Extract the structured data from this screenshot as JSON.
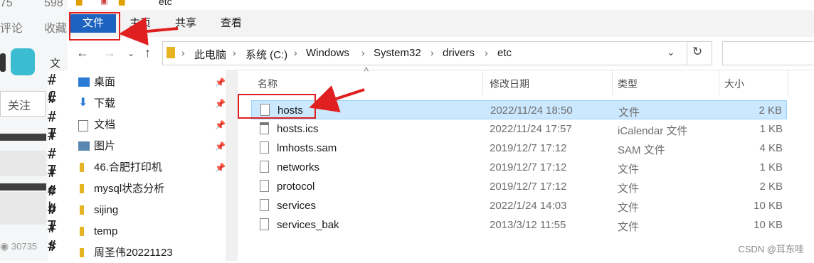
{
  "background": {
    "stat_a": "75",
    "stat_b": "598",
    "comment_label": "评论",
    "favorite_label": "收藏",
    "follow_label": "关注",
    "menu_label": "文",
    "view_count": "30735",
    "hash_lines": [
      "# C",
      "#",
      "# T",
      "#",
      "# T",
      "# e",
      "# b",
      "# T",
      "# s",
      "#"
    ]
  },
  "window": {
    "title": "etc",
    "ribbon_tabs": [
      "文件",
      "主页",
      "共享",
      "查看"
    ],
    "path": [
      "此电脑",
      "系统 (C:)",
      "Windows",
      "System32",
      "drivers",
      "etc"
    ],
    "nav_items": [
      {
        "label": "桌面",
        "icon": "desktop-icon",
        "pinned": true
      },
      {
        "label": "下载",
        "icon": "download-icon",
        "pinned": true
      },
      {
        "label": "文档",
        "icon": "document-icon",
        "pinned": true
      },
      {
        "label": "图片",
        "icon": "picture-icon",
        "pinned": true
      },
      {
        "label": "46.合肥打印机",
        "icon": "folder-icon",
        "pinned": true
      },
      {
        "label": "mysql状态分析",
        "icon": "folder-icon",
        "pinned": false
      },
      {
        "label": "sijing",
        "icon": "folder-icon",
        "pinned": false
      },
      {
        "label": "temp",
        "icon": "folder-icon",
        "pinned": false
      },
      {
        "label": "周圣伟20221123",
        "icon": "folder-icon",
        "pinned": false
      }
    ],
    "columns": {
      "name": "名称",
      "date": "修改日期",
      "type": "类型",
      "size": "大小"
    },
    "files": [
      {
        "name": "hosts",
        "date": "2022/11/24 18:50",
        "type": "文件",
        "size": "2 KB",
        "selected": true
      },
      {
        "name": "hosts.ics",
        "date": "2022/11/24 17:57",
        "type": "iCalendar 文件",
        "size": "1 KB",
        "selected": false
      },
      {
        "name": "lmhosts.sam",
        "date": "2019/12/7 17:12",
        "type": "SAM 文件",
        "size": "4 KB",
        "selected": false
      },
      {
        "name": "networks",
        "date": "2019/12/7 17:12",
        "type": "文件",
        "size": "1 KB",
        "selected": false
      },
      {
        "name": "protocol",
        "date": "2019/12/7 17:12",
        "type": "文件",
        "size": "2 KB",
        "selected": false
      },
      {
        "name": "services",
        "date": "2022/1/24 14:03",
        "type": "文件",
        "size": "10 KB",
        "selected": false
      },
      {
        "name": "services_bak",
        "date": "2013/3/12 11:55",
        "type": "文件",
        "size": "10 KB",
        "selected": false
      }
    ]
  },
  "watermark": "CSDN @耳东哇",
  "colors": {
    "file_tab": "#1b63bf",
    "selection": "#cce8ff",
    "annotation_red": "#e02020"
  }
}
